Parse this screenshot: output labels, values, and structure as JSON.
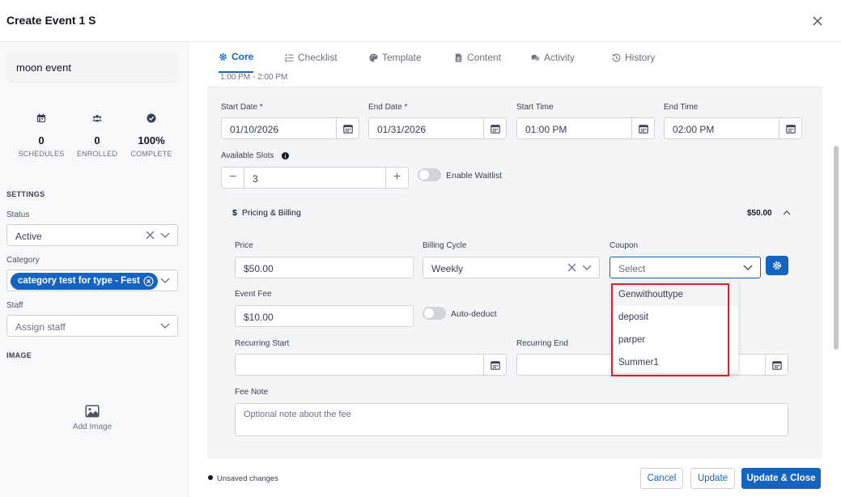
{
  "header": {
    "title": "Create Event 1 S"
  },
  "sidebar": {
    "event_name": "moon event",
    "stats": [
      {
        "value": "0",
        "label": "SCHEDULES",
        "icon": "calendar-icon"
      },
      {
        "value": "0",
        "label": "ENROLLED",
        "icon": "users-icon"
      },
      {
        "value": "100%",
        "label": "COMPLETE",
        "icon": "check-circle-icon"
      }
    ],
    "settings_label": "SETTINGS",
    "status": {
      "label": "Status",
      "value": "Active"
    },
    "category": {
      "label": "Category",
      "chip": "category test for type - Fest"
    },
    "staff": {
      "label": "Staff",
      "placeholder": "Assign staff"
    },
    "image_label": "IMAGE",
    "add_image": "Add Image"
  },
  "tabs": [
    {
      "label": "Core",
      "active": true
    },
    {
      "label": "Checklist"
    },
    {
      "label": "Template"
    },
    {
      "label": "Content"
    },
    {
      "label": "Activity"
    },
    {
      "label": "History"
    }
  ],
  "core": {
    "cut_time": "1:00 PM - 2:00 PM",
    "start_date": {
      "label": "Start Date *",
      "value": "01/10/2026"
    },
    "end_date": {
      "label": "End Date *",
      "value": "01/31/2026"
    },
    "start_time": {
      "label": "Start Time",
      "value": "01:00 PM"
    },
    "end_time": {
      "label": "End Time",
      "value": "02:00 PM"
    },
    "available_slots": {
      "label": "Available Slots",
      "value": "3"
    },
    "waitlist_label": "Enable Waitlist",
    "pricing": {
      "title": "Pricing & Billing",
      "total": "$50.00",
      "price": {
        "label": "Price",
        "value": "$50.00"
      },
      "billing_cycle": {
        "label": "Billing Cycle",
        "value": "Weekly"
      },
      "coupon": {
        "label": "Coupon",
        "placeholder": "Select",
        "options": [
          "Genwithouttype",
          "deposit",
          "parper",
          "Summer1"
        ]
      },
      "event_fee": {
        "label": "Event Fee",
        "value": "$10.00"
      },
      "auto_deduct_label": "Auto-deduct",
      "recurring_start": {
        "label": "Recurring Start"
      },
      "recurring_end": {
        "label": "Recurring End"
      },
      "fee_note": {
        "label": "Fee Note",
        "placeholder": "Optional note about the fee"
      }
    }
  },
  "footer": {
    "unsaved": "Unsaved changes",
    "cancel": "Cancel",
    "update": "Update",
    "update_close": "Update & Close"
  },
  "colors": {
    "accent": "#1565c0",
    "highlight": "#e11d2a"
  }
}
